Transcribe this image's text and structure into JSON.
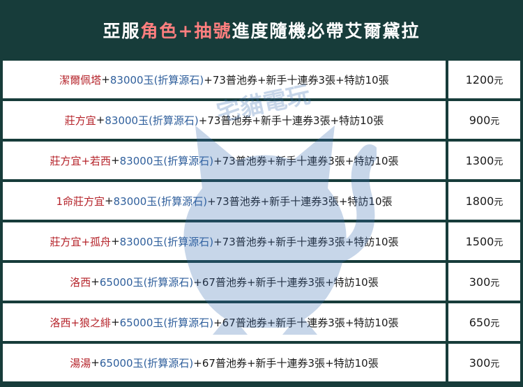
{
  "header": {
    "part1": "亞服",
    "part2": "角色+抽號",
    "part3": "進度隨機",
    "part4": "必帶艾爾黛拉"
  },
  "rows": [
    {
      "character": "潔爾佩塔",
      "jade": "83000玉",
      "note": "(折算源石)",
      "rest": "+73普池券+新手十連券3張+特訪10張",
      "price": "1200",
      "unit": "元"
    },
    {
      "character": "莊方宜",
      "jade": "83000玉",
      "note": "(折算源石)",
      "rest": "+73普池券+新手十連券3張+特訪10張",
      "price": "900",
      "unit": "元"
    },
    {
      "character": "莊方宜+若西",
      "jade": "83000玉",
      "note": "(折算源石)",
      "rest": "+73普池券+新手十連券3張+特訪10張",
      "price": "1300",
      "unit": "元"
    },
    {
      "character": "1命莊方宜",
      "jade": "83000玉",
      "note": "(折算源石)",
      "rest": "+73普池券+新手十連券3張+特訪10張",
      "price": "1800",
      "unit": "元"
    },
    {
      "character": "莊方宜+孤舟",
      "jade": "83000玉",
      "note": "(折算源石)",
      "rest": "+73普池券+新手十連券3張+特訪10張",
      "price": "1500",
      "unit": "元"
    },
    {
      "character": "洛西",
      "jade": "65000玉",
      "note": "(折算源石)",
      "rest": "+67普池券+新手十連券3張+特訪10張",
      "price": "300",
      "unit": "元"
    },
    {
      "character": "洛西+狼之緋",
      "jade": "65000玉",
      "note": "(折算源石)",
      "rest": "+67普池券+新手十連券3張+特訪10張",
      "price": "650",
      "unit": "元"
    },
    {
      "character": "湯湯",
      "jade": "65000玉",
      "note": "(折算源石)",
      "rest": "+67普池券+新手十連券3張+特訪10張",
      "price": "300",
      "unit": "元"
    }
  ],
  "colors": {
    "background": "#173c3a",
    "accent": "#ff7f7f",
    "character": "#b5232a",
    "jade": "#2f5f9c"
  },
  "watermark": {
    "text": "宅貓電玩"
  }
}
